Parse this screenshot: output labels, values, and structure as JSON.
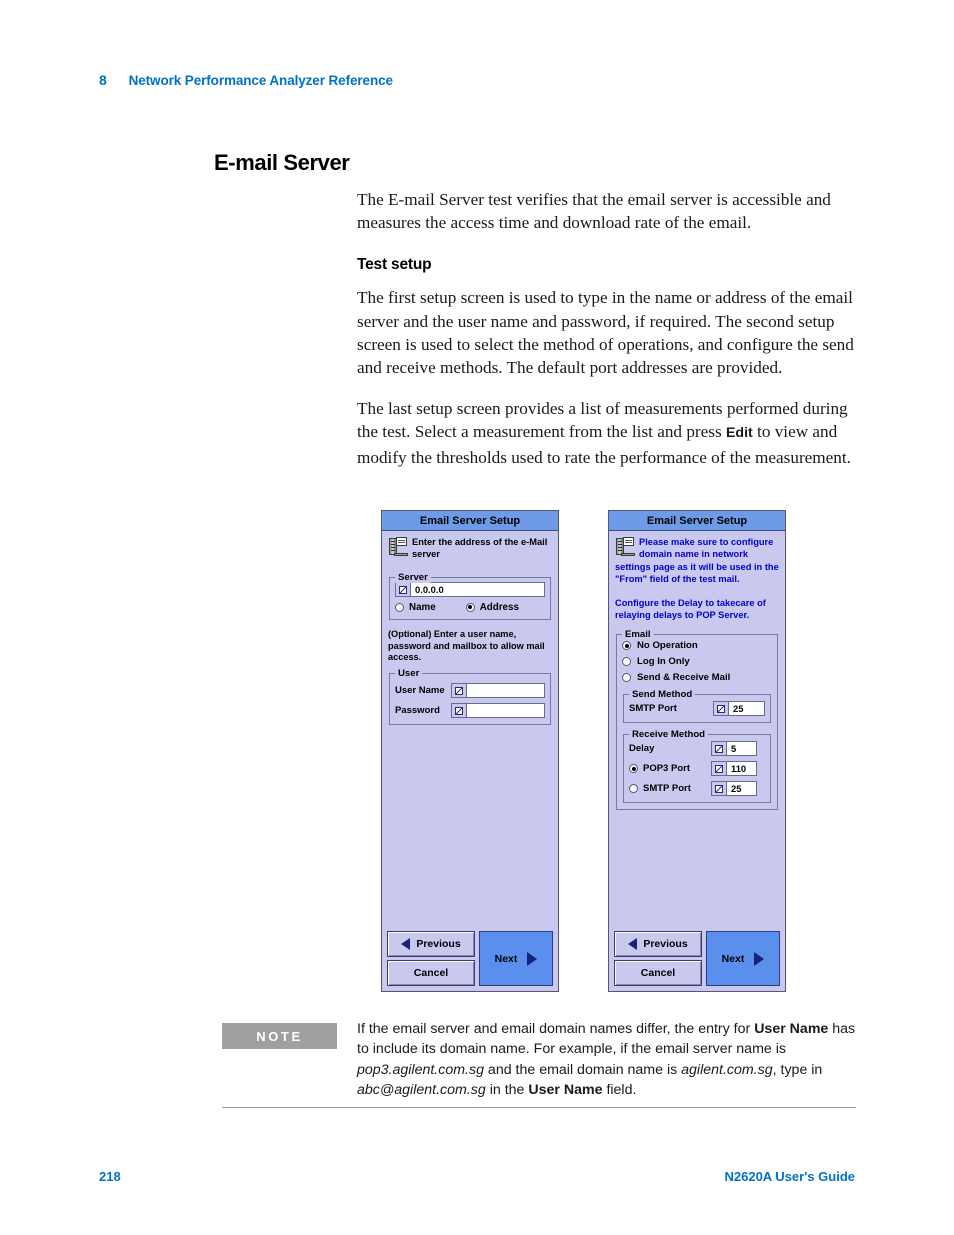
{
  "header": {
    "chapter_number": "8",
    "chapter_title": "Network Performance Analyzer Reference"
  },
  "section": {
    "heading": "E-mail Server",
    "intro_paragraph": "The E-mail Server test verifies that the email server is accessible and measures the access time and download rate of the email.",
    "subheading": "Test setup",
    "paragraph_1": "The first setup screen is used to type in the name or address of the email server and the user name and password, if required. The second setup screen is used to select the method of operations, and configure the send and receive methods. The default port addresses are provided.",
    "paragraph_2_before": "The last setup screen provides a list of measurements performed during the test. Select a measurement from the list and press ",
    "paragraph_2_bold": "Edit",
    "paragraph_2_after": " to view and modify the thresholds used to rate the performance of the measurement."
  },
  "screenshot_left": {
    "title": "Email Server Setup",
    "icon": "server-icon",
    "info_text": "Enter the address of the e-Mail server",
    "server_group": {
      "legend": "Server",
      "address_value": "0.0.0.0",
      "options": [
        {
          "label": "Name",
          "selected": false
        },
        {
          "label": "Address",
          "selected": true
        }
      ]
    },
    "hint_text": "(Optional) Enter a user name, password and mailbox to allow mail access.",
    "user_group": {
      "legend": "User",
      "fields": [
        {
          "label": "User Name",
          "value": ""
        },
        {
          "label": "Password",
          "value": ""
        }
      ]
    },
    "buttons": {
      "previous": "Previous",
      "cancel": "Cancel",
      "next": "Next"
    }
  },
  "screenshot_right": {
    "title": "Email Server Setup",
    "icon": "server-icon",
    "info_text": "Please make sure to configure  domain name in network settings page as it will be used in the \"From\" field of the test mail.",
    "info_note": "Configure the  Delay  to takecare of relaying delays to POP Server.",
    "email_group": {
      "legend": "Email",
      "options": [
        {
          "label": "No Operation",
          "selected": true
        },
        {
          "label": "Log In Only",
          "selected": false
        },
        {
          "label": "Send & Receive Mail",
          "selected": false
        }
      ]
    },
    "send_method_group": {
      "legend": "Send Method",
      "smtp_port_label": "SMTP Port",
      "smtp_port_value": "25"
    },
    "receive_method_group": {
      "legend": "Receive Method",
      "delay_label": "Delay",
      "delay_value": "5",
      "pop3_label": "POP3 Port",
      "pop3_value": "110",
      "pop3_selected": true,
      "smtp_label": "SMTP Port",
      "smtp_value": "25",
      "smtp_selected": false
    },
    "buttons": {
      "previous": "Previous",
      "cancel": "Cancel",
      "next": "Next"
    }
  },
  "note": {
    "label": "NOTE",
    "seg_1": "If the email server and email domain names differ, the entry for ",
    "seg_2_bold": "User Name",
    "seg_3": " has to include its domain name. For example, if the email server name is ",
    "seg_4_italic": "pop3.agilent.com.sg",
    "seg_5": " and the email domain name is ",
    "seg_6_italic": "agilent.com.sg",
    "seg_7": ", type in ",
    "seg_8_italic": "abc@agilent.com.sg",
    "seg_9": " in the ",
    "seg_10_bold": "User Name",
    "seg_11": " field."
  },
  "footer": {
    "page_number": "218",
    "guide_title": "N2620A User's Guide"
  },
  "colors": {
    "brand_blue": "#0072C6",
    "dialog_titlebar": "#6E9BE8",
    "dialog_body": "#C9C9EF",
    "next_button": "#5B8FEE",
    "note_label_bg": "#A0A0A0",
    "info_blue": "#0000CC"
  }
}
